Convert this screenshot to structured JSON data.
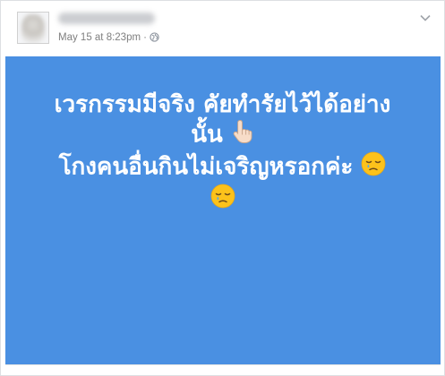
{
  "post": {
    "timestamp": "May 15 at 8:23pm",
    "separator": "·",
    "privacy_icon": "globe-icon",
    "menu_icon": "chevron-down-icon",
    "background_color": "#4a90e2",
    "text_color": "#ffffff",
    "text_lines": [
      "เวรกรรมมีจริง คัยทำรัยไว้ได้อย่าง",
      "นั้น",
      "โกงคนอื่นกินไม่เจริญหรอกค่ะ",
      ""
    ],
    "emojis": [
      "backhand-index-pointing-up-icon",
      "sleepy-face-icon",
      "sleepy-face-icon"
    ]
  }
}
